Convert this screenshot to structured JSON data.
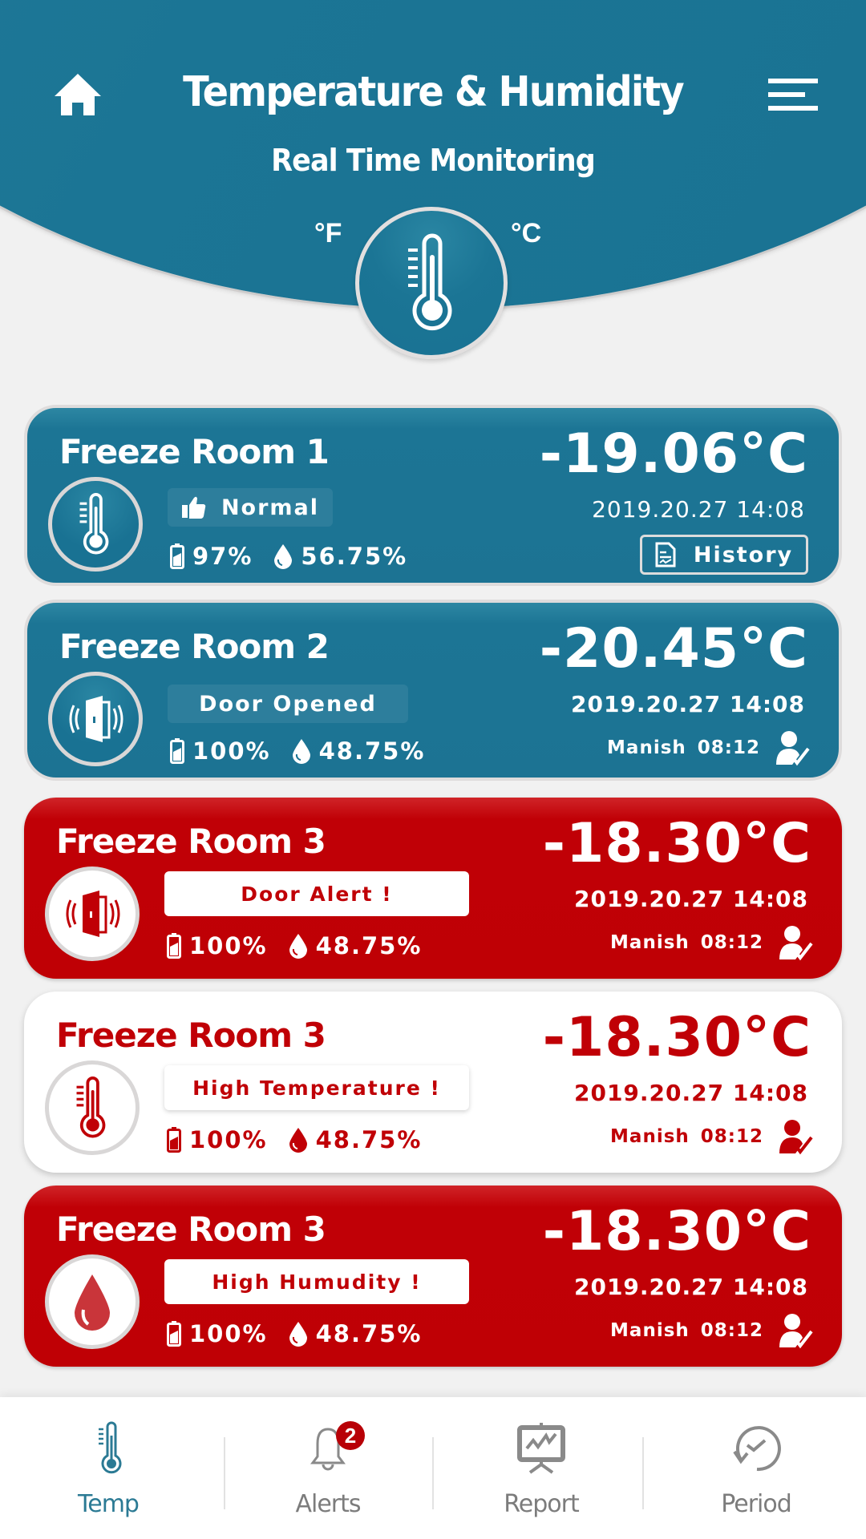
{
  "header": {
    "title": "Temperature & Humidity",
    "subtitle": "Real Time  Monitoring",
    "unit_fahrenheit": "°F",
    "unit_celsius": "°C",
    "colors": {
      "primary": "#1b7595",
      "alert": "#c00006"
    }
  },
  "cards": [
    {
      "name": "Freeze Room 1",
      "temperature": "-19.06°C",
      "datetime": "2019.20.27 14:08",
      "status": "Normal",
      "battery": "97%",
      "humidity": "56.75%",
      "history_label": "History",
      "icon": "thermometer-icon",
      "theme": "blue"
    },
    {
      "name": "Freeze Room 2",
      "temperature": "-20.45°C",
      "datetime": "2019.20.27 14:08",
      "status": "Door Opened",
      "battery": "100%",
      "humidity": "48.75%",
      "ack_user": "Manish",
      "ack_time": "08:12",
      "icon": "door-open-icon",
      "theme": "blue"
    },
    {
      "name": "Freeze Room 3",
      "temperature": "-18.30°C",
      "datetime": "2019.20.27 14:08",
      "status": "Door Alert !",
      "battery": "100%",
      "humidity": "48.75%",
      "ack_user": "Manish",
      "ack_time": "08:12",
      "icon": "door-open-icon",
      "theme": "red"
    },
    {
      "name": "Freeze Room 3",
      "temperature": "-18.30°C",
      "datetime": "2019.20.27 14:08",
      "status": "High Temperature !",
      "battery": "100%",
      "humidity": "48.75%",
      "ack_user": "Manish",
      "ack_time": "08:12",
      "icon": "thermometer-icon",
      "theme": "white"
    },
    {
      "name": "Freeze Room 3",
      "temperature": "-18.30°C",
      "datetime": "2019.20.27 14:08",
      "status": "High Humudity !",
      "battery": "100%",
      "humidity": "48.75%",
      "ack_user": "Manish",
      "ack_time": "08:12",
      "icon": "water-drop-icon",
      "theme": "red"
    }
  ],
  "nav": {
    "items": [
      {
        "label": "Temp",
        "icon": "thermometer-icon",
        "active": true
      },
      {
        "label": "Alerts",
        "icon": "bell-icon",
        "badge": "2"
      },
      {
        "label": "Report",
        "icon": "presentation-chart-icon"
      },
      {
        "label": "Period",
        "icon": "history-clock-icon"
      }
    ]
  }
}
